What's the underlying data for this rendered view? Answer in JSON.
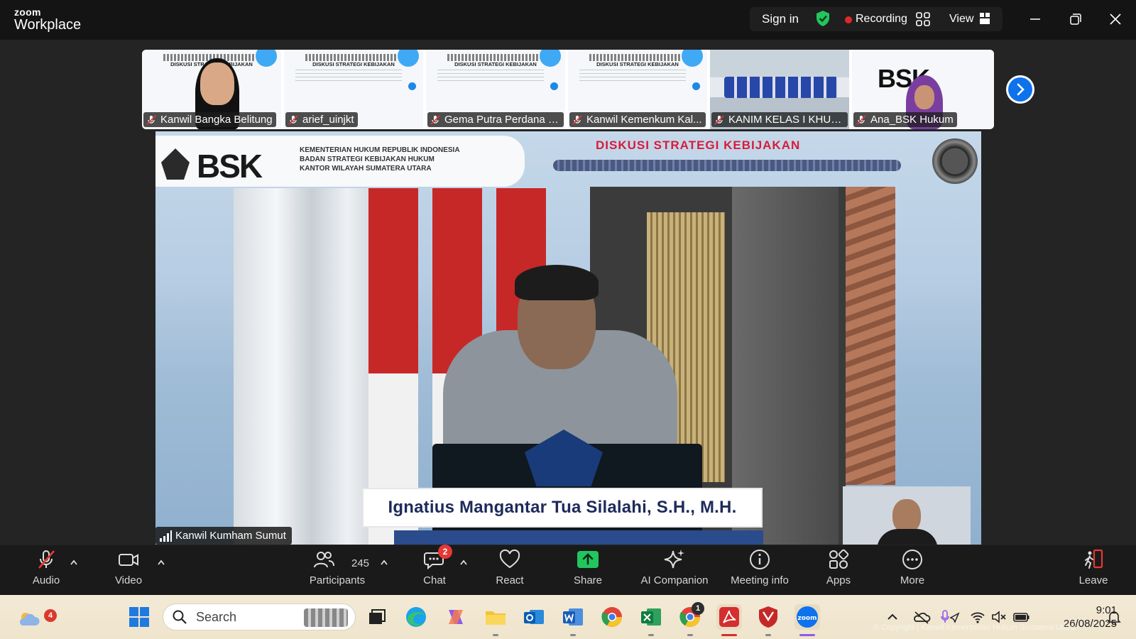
{
  "window": {
    "logo_line1": "zoom",
    "logo_line2": "Workplace",
    "sign_in": "Sign in",
    "recording_label": "Recording",
    "view_label": "View",
    "accent": "#0e72ed",
    "recording_color": "#e02828",
    "shield_color": "#22c55e"
  },
  "participant_strip": {
    "tiles": [
      {
        "name": "Kanwil Bangka Belitung",
        "slide_title": "DISKUSI STRATEGI KEBIJAKAN",
        "muted": true
      },
      {
        "name": "arief_uinjkt",
        "slide_title": "DISKUSI STRATEGI KEBIJAKAN",
        "muted": true
      },
      {
        "name": "Gema Putra Perdana S...",
        "slide_title": "DISKUSI STRATEGI KEBIJAKAN",
        "muted": true
      },
      {
        "name": "Kanwil Kemenkum Kal...",
        "slide_title": "DISKUSI STRATEGI KEBIJAKAN",
        "muted": true
      },
      {
        "name": "KANIM KELAS I KHUS...",
        "muted": true
      },
      {
        "name": "Ana_BSK Hukum",
        "slide_logo": "BSK",
        "muted": true
      }
    ],
    "next_icon": "chevron-right-icon"
  },
  "main_video": {
    "banner_logo": "BSK",
    "banner_subtitle_lines": [
      "KEMENTERIAN HUKUM REPUBLIK INDONESIA",
      "BADAN STRATEGI KEBIJAKAN HUKUM",
      "KANTOR WILAYAH SUMATERA UTARA"
    ],
    "banner_title": "DISKUSI STRATEGI KEBIJAKAN",
    "speaker_caption": "Ignatius Mangantar Tua Silalahi, S.H., M.H.",
    "source_label": "Kanwil Kumham Sumut"
  },
  "toolbar": {
    "audio": "Audio",
    "video": "Video",
    "participants": "Participants",
    "participants_count": "245",
    "chat": "Chat",
    "chat_badge": "2",
    "react": "React",
    "share": "Share",
    "ai_companion": "AI Companion",
    "meeting_info": "Meeting info",
    "apps": "Apps",
    "more": "More",
    "leave": "Leave"
  },
  "taskbar": {
    "weather_badge": "4",
    "search_placeholder": "Search",
    "chrome_badge": "1",
    "time": "9:01",
    "date": "26/08/2025",
    "watermark": "© Copyright | Kanwil Kementerian Hukum Sumatera Utara"
  }
}
